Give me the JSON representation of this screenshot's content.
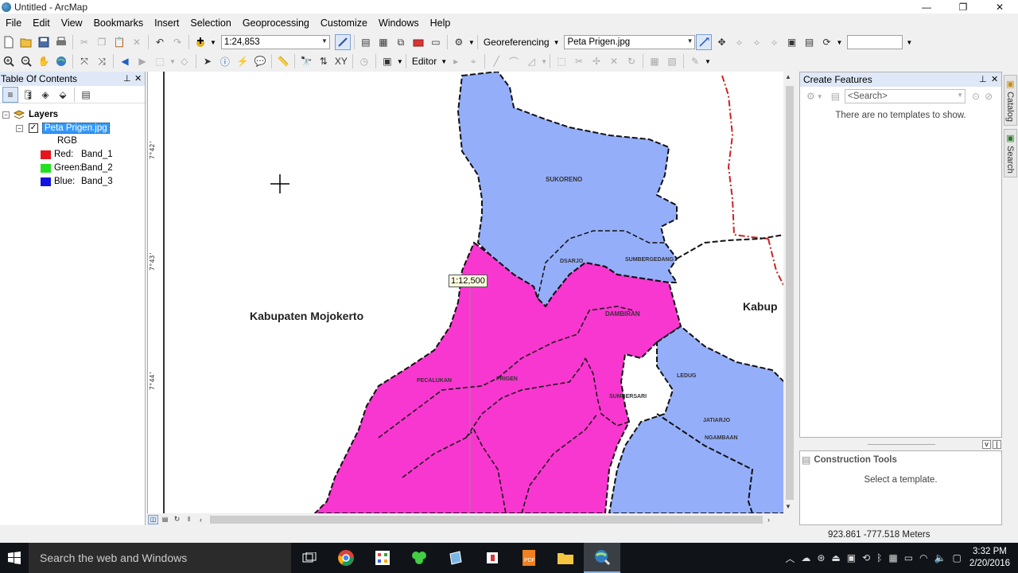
{
  "window": {
    "title": "Untitled - ArcMap",
    "controls": [
      "—",
      "❐",
      "✕"
    ]
  },
  "menu": [
    "File",
    "Edit",
    "View",
    "Bookmarks",
    "Insert",
    "Selection",
    "Geoprocessing",
    "Customize",
    "Windows",
    "Help"
  ],
  "toolbar": {
    "scale": "1:24,853",
    "georeferencing_label": "Georeferencing",
    "layer_combo": "Peta Prigen.jpg",
    "editor_label": "Editor",
    "search_box_value": ""
  },
  "toc": {
    "title": "Table Of Contents",
    "root": "Layers",
    "layer": "Peta Prigen.jpg",
    "layer_checked": true,
    "rgb_label": "RGB",
    "bands": [
      {
        "label": "Red:",
        "band": "Band_1",
        "color": "#e8141b"
      },
      {
        "label": "Green:",
        "band": "Band_2",
        "color": "#22e022"
      },
      {
        "label": "Blue:",
        "band": "Band_3",
        "color": "#1414e0"
      }
    ]
  },
  "map": {
    "scale_tooltip": "1:12,500",
    "labels": {
      "mojokerto": "Kabupaten Mojokerto",
      "kabup_right": "Kabup",
      "sukoreno": "SUKORENO",
      "dsarjo": "DSARJO",
      "sumbergedang": "SUMBERGEDANG",
      "dambiran": "DAMBIRAN",
      "ledug": "LEDUG",
      "pecalukan": "PECALUKAN",
      "prigen": "PRIGEN",
      "sumbersari": "SUMBERSARI",
      "jatiarjo": "JATIARJO",
      "ngambaan": "NGAMBAAN"
    },
    "colors": {
      "magenta": "#f737cf",
      "blue": "#94aefa",
      "boundary": "#cc2222"
    }
  },
  "create_features": {
    "title": "Create Features",
    "search_placeholder": "<Search>",
    "empty_message": "There are no templates to show."
  },
  "construction_tools": {
    "title": "Construction Tools",
    "empty_message": "Select a template."
  },
  "side_tabs": [
    "Catalog",
    "Search"
  ],
  "status": {
    "coords": "923.861  -777.518 Meters"
  },
  "taskbar": {
    "search_placeholder": "Search the web and Windows",
    "time": "3:32 PM",
    "date": "2/20/2016"
  }
}
